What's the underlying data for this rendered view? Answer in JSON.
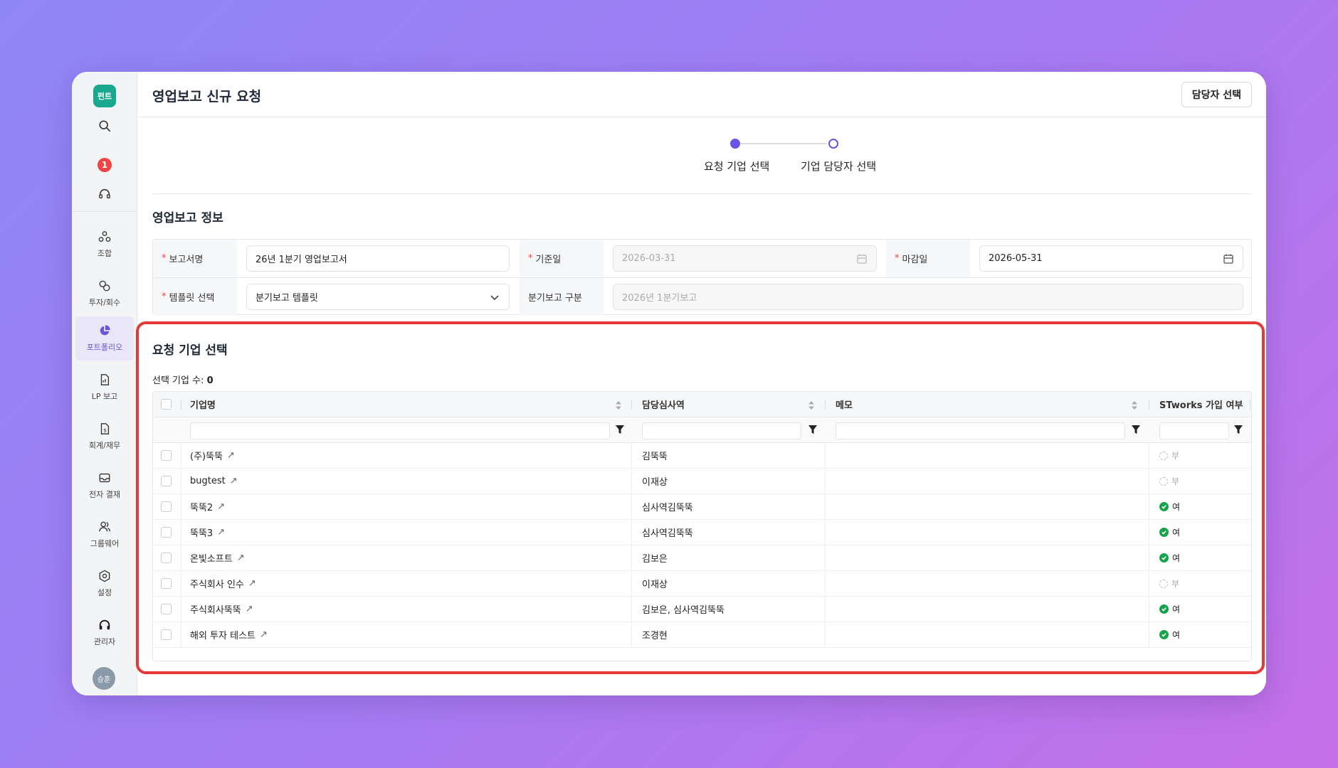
{
  "sidebar": {
    "logo": "펀트",
    "badge_count": "1",
    "items": [
      {
        "label": "조합",
        "icon": "union-icon"
      },
      {
        "label": "투자/회수",
        "icon": "invest-icon"
      },
      {
        "label": "포트폴리오",
        "icon": "portfolio-pie-icon",
        "active": true
      },
      {
        "label": "LP 보고",
        "icon": "report-doc-icon"
      },
      {
        "label": "회계/재무",
        "icon": "finance-doc-icon"
      },
      {
        "label": "전자 결재",
        "icon": "inbox-icon"
      },
      {
        "label": "그룹웨어",
        "icon": "group-icon"
      },
      {
        "label": "설정",
        "icon": "gear-icon"
      },
      {
        "label": "관리자",
        "icon": "admin-headset-icon"
      }
    ],
    "avatar": "승훈"
  },
  "header": {
    "title": "영업보고 신규 요청",
    "assign_button": "담당자 선택"
  },
  "stepper": {
    "steps": [
      "요청 기업 선택",
      "기업 담당자 선택"
    ],
    "current": 0
  },
  "info": {
    "title": "영업보고 정보",
    "report_name_label": "보고서명",
    "report_name_value": "26년 1분기 영업보고서",
    "base_date_label": "기준일",
    "base_date_value": "2026-03-31",
    "due_date_label": "마감일",
    "due_date_value": "2026-05-31",
    "template_label": "템플릿 선택",
    "template_value": "분기보고 템플릿",
    "quarter_label": "분기보고 구분",
    "quarter_value": "2026년 1분기보고"
  },
  "companies": {
    "title": "요청 기업 선택",
    "count_label": "선택 기업 수:",
    "count_value": "0",
    "columns": [
      "기업명",
      "담당심사역",
      "메모",
      "STworks 가입 여부"
    ],
    "rows": [
      {
        "name": "(주)뚝뚝",
        "manager": "김뚝뚝",
        "memo": "",
        "joined": "부",
        "joined_flag": false
      },
      {
        "name": "bugtest",
        "manager": "이재상",
        "memo": "",
        "joined": "부",
        "joined_flag": false
      },
      {
        "name": "뚝뚝2",
        "manager": "심사역김뚝뚝",
        "memo": "",
        "joined": "여",
        "joined_flag": true
      },
      {
        "name": "뚝뚝3",
        "manager": "심사역김뚝뚝",
        "memo": "",
        "joined": "여",
        "joined_flag": true
      },
      {
        "name": "온빛소프트",
        "manager": "김보은",
        "memo": "",
        "joined": "여",
        "joined_flag": true
      },
      {
        "name": "주식회사 인수",
        "manager": "이재상",
        "memo": "",
        "joined": "부",
        "joined_flag": false
      },
      {
        "name": "주식회사뚝뚝",
        "manager": "김보은, 심사역김뚝뚝",
        "memo": "",
        "joined": "여",
        "joined_flag": true
      },
      {
        "name": "해외 투자 테스트",
        "manager": "조경현",
        "memo": "",
        "joined": "여",
        "joined_flag": true
      }
    ]
  },
  "colors": {
    "accent": "#6656e6",
    "highlight": "#e53935",
    "success": "#16a34a",
    "brand": "#17a88f"
  }
}
